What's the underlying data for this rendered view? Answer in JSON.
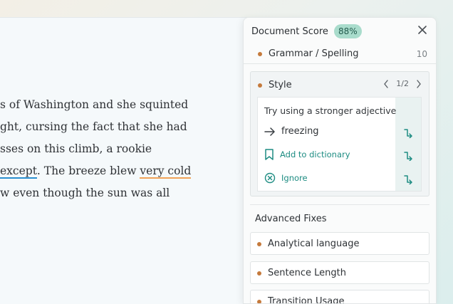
{
  "document": {
    "lines": [
      {
        "a": "s of Washington and she squinted",
        "b": "",
        "c": "",
        "d": ""
      },
      {
        "a": "ght, cursing the fact that she had",
        "b": "",
        "c": "",
        "d": ""
      },
      {
        "a": "sses on this climb, a rookie",
        "b": "",
        "c": "",
        "d": ""
      },
      {
        "a": "",
        "b": "except",
        "c": ". The breeze blew ",
        "d": "very cold"
      },
      {
        "a": "w even though the sun was all",
        "b": "",
        "c": "",
        "d": ""
      }
    ]
  },
  "panel": {
    "title": "Document Score",
    "score": "88%",
    "close_icon": "close-icon",
    "grammar": {
      "label": "Grammar / Spelling",
      "count": "10"
    },
    "style": {
      "label": "Style",
      "page": "1/2",
      "suggestion_title": "Try using a stronger adjective",
      "replacement": "freezing",
      "add_to_dictionary": "Add to dictionary",
      "ignore": "Ignore"
    },
    "advanced": {
      "title": "Advanced Fixes",
      "items": [
        {
          "label": "Analytical language"
        },
        {
          "label": "Sentence Length"
        },
        {
          "label": "Transition Usage"
        }
      ]
    }
  },
  "colors": {
    "accent": "#1d8c82",
    "dot": "#c57a3c",
    "badge_bg": "#a9dccc",
    "underline_blue": "#2a8fd0",
    "underline_orange": "#f1a257"
  }
}
